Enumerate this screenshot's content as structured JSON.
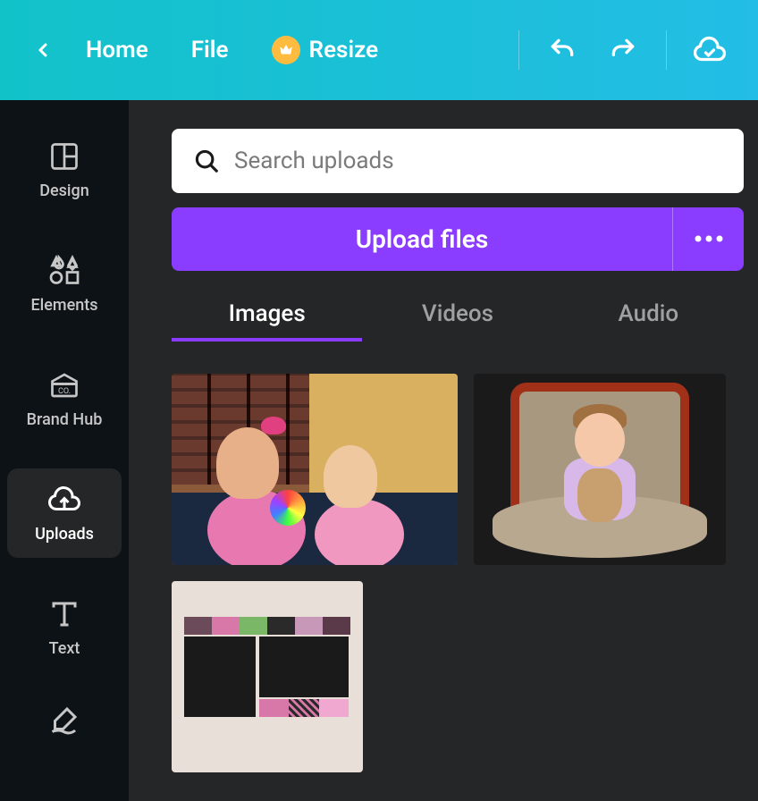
{
  "topbar": {
    "home_label": "Home",
    "file_label": "File",
    "resize_label": "Resize"
  },
  "sidebar": {
    "items": [
      {
        "label": "Design"
      },
      {
        "label": "Elements"
      },
      {
        "label": "Brand Hub"
      },
      {
        "label": "Uploads"
      },
      {
        "label": "Text"
      }
    ]
  },
  "content": {
    "search_placeholder": "Search uploads",
    "upload_label": "Upload files",
    "tabs": [
      {
        "label": "Images"
      },
      {
        "label": "Videos"
      },
      {
        "label": "Audio"
      }
    ]
  }
}
